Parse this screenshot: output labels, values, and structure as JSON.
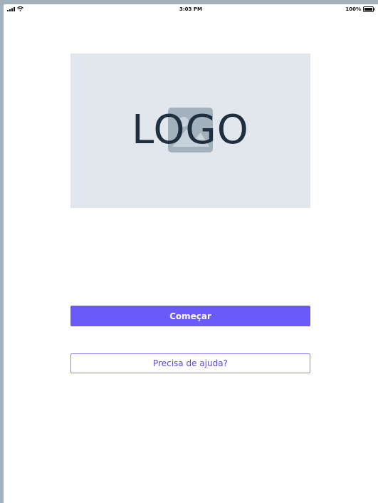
{
  "status_bar": {
    "time": "3:03 PM",
    "battery_level": "100%",
    "signal_icon": "cellular-signal-icon",
    "wifi_icon": "wifi-icon",
    "battery_icon": "battery-full-icon"
  },
  "logo": {
    "text": "LOGO",
    "placeholder_icon": "image-placeholder-icon",
    "background_color": "#e1e7ed",
    "text_color": "#1f2f3f"
  },
  "actions": {
    "start_label": "Começar",
    "help_label": "Precisa de ajuda?"
  },
  "colors": {
    "primary": "#6a5af9",
    "outline": "#8e82f6",
    "frame": "#a3b1bd"
  }
}
